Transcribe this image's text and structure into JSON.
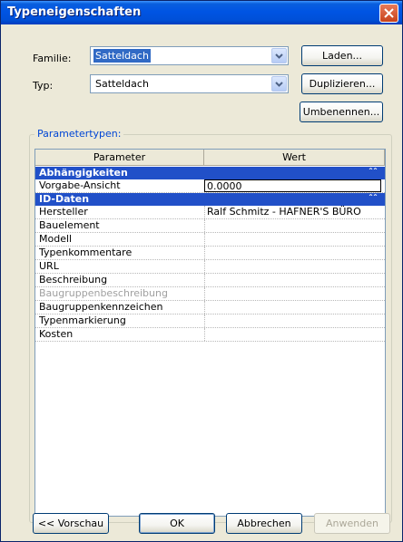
{
  "window": {
    "title": "Typeneigenschaften"
  },
  "form": {
    "familie_label": "Familie:",
    "familie_value": "Satteldach",
    "typ_label": "Typ:",
    "typ_value": "Satteldach"
  },
  "buttons": {
    "laden": "Laden...",
    "duplizieren": "Duplizieren...",
    "umbenennen": "Umbenennen...",
    "vorschau": "<< Vorschau",
    "ok": "OK",
    "abbrechen": "Abbrechen",
    "anwenden": "Anwenden"
  },
  "params": {
    "group_label": "Parametertypen:",
    "col_parameter": "Parameter",
    "col_wert": "Wert",
    "sections": [
      {
        "title": "Abhängigkeiten",
        "rows": [
          {
            "param": "Vorgabe-Ansicht",
            "value": "0.0000"
          }
        ]
      },
      {
        "title": "ID-Daten",
        "rows": [
          {
            "param": "Hersteller",
            "value": "Ralf Schmitz - HAFNER'S BÜRO"
          },
          {
            "param": "Bauelement",
            "value": ""
          },
          {
            "param": "Modell",
            "value": ""
          },
          {
            "param": "Typenkommentare",
            "value": ""
          },
          {
            "param": "URL",
            "value": ""
          },
          {
            "param": "Beschreibung",
            "value": ""
          },
          {
            "param": "Baugruppenbeschreibung",
            "value": ""
          },
          {
            "param": "Baugruppenkennzeichen",
            "value": ""
          },
          {
            "param": "Typenmarkierung",
            "value": ""
          },
          {
            "param": "Kosten",
            "value": ""
          }
        ]
      }
    ]
  },
  "colors": {
    "title_bar": "#0054e3",
    "section_header": "#2150c8",
    "group_label": "#0046d5",
    "disabled_text": "#a0a0a0"
  },
  "icons": {
    "close": "close-icon",
    "dropdown": "chevron-down-icon",
    "collapse": "double-chevron-up-icon"
  }
}
